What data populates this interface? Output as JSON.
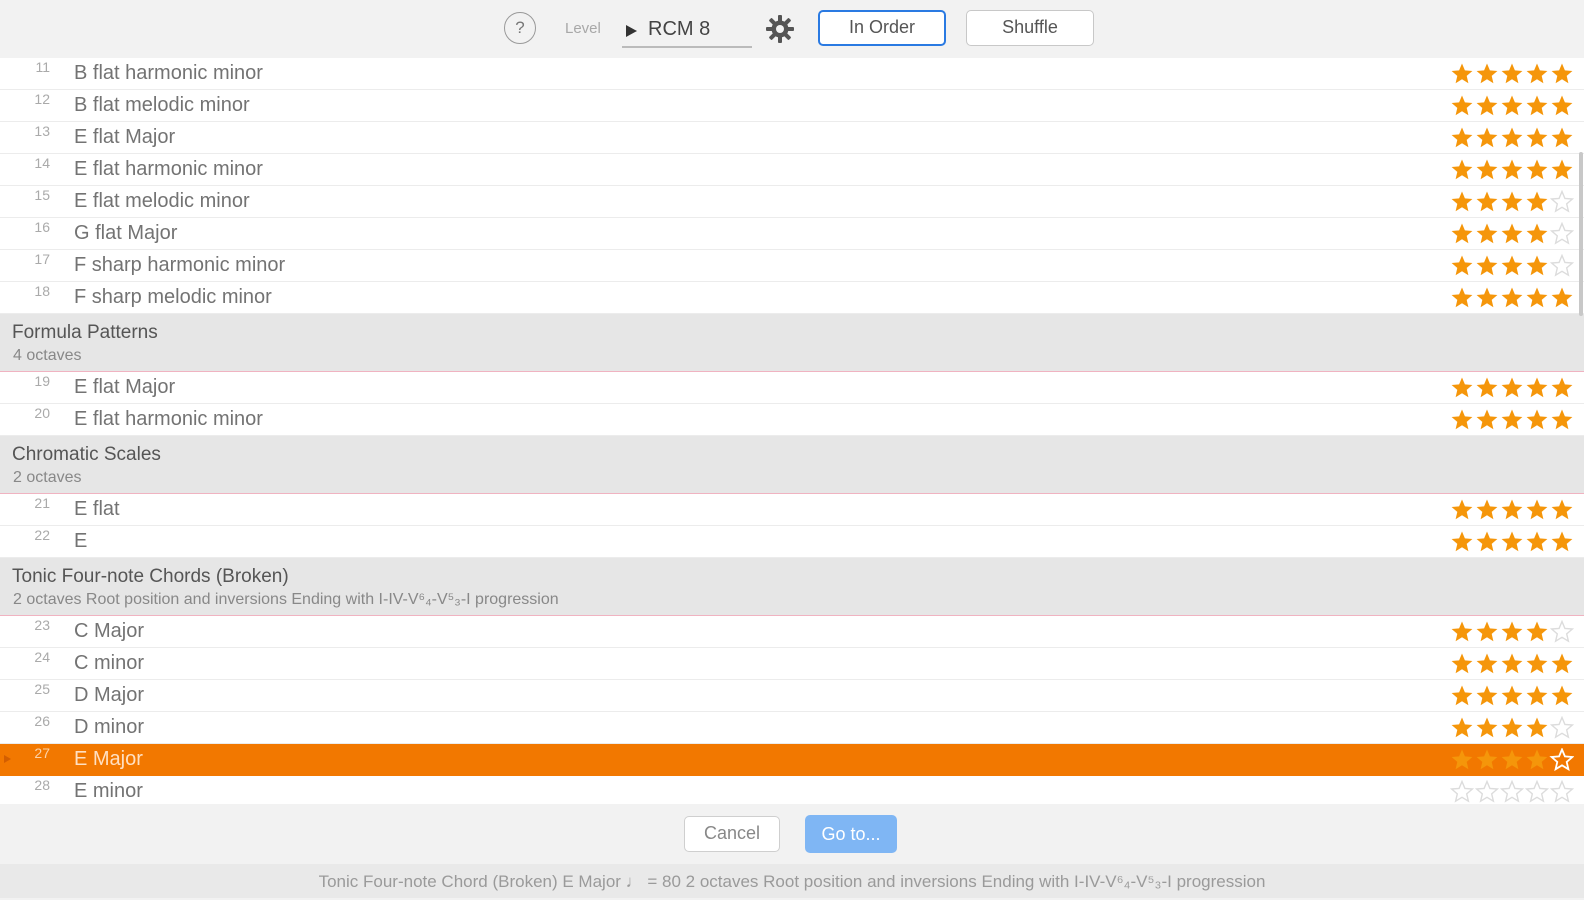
{
  "toolbar": {
    "help_label": "?",
    "level_label": "Level",
    "level_value": "RCM 8",
    "in_order_label": "In Order",
    "shuffle_label": "Shuffle"
  },
  "colors": {
    "accent": "#f27800",
    "star_filled": "#f5960a",
    "star_empty": "#dcdcdc",
    "selected_star_outline": "#ffffff",
    "primary_button": "#7fb6f4",
    "focus_border": "#2a7ae2"
  },
  "list": [
    {
      "kind": "row",
      "num": "11",
      "name": "B flat harmonic minor",
      "rating": 5
    },
    {
      "kind": "row",
      "num": "12",
      "name": "B flat melodic minor",
      "rating": 5
    },
    {
      "kind": "row",
      "num": "13",
      "name": "E flat Major",
      "rating": 5
    },
    {
      "kind": "row",
      "num": "14",
      "name": "E flat harmonic minor",
      "rating": 5
    },
    {
      "kind": "row",
      "num": "15",
      "name": "E flat melodic minor",
      "rating": 4
    },
    {
      "kind": "row",
      "num": "16",
      "name": "G flat Major",
      "rating": 4
    },
    {
      "kind": "row",
      "num": "17",
      "name": "F sharp harmonic minor",
      "rating": 4
    },
    {
      "kind": "row",
      "num": "18",
      "name": "F sharp melodic minor",
      "rating": 5
    },
    {
      "kind": "section",
      "title": "Formula Patterns",
      "sub": "4 octaves"
    },
    {
      "kind": "row",
      "num": "19",
      "name": "E flat Major",
      "rating": 5
    },
    {
      "kind": "row",
      "num": "20",
      "name": "E flat harmonic minor",
      "rating": 5
    },
    {
      "kind": "section",
      "title": "Chromatic Scales",
      "sub": "2 octaves"
    },
    {
      "kind": "row",
      "num": "21",
      "name": "E flat",
      "rating": 5
    },
    {
      "kind": "row",
      "num": "22",
      "name": "E",
      "rating": 5
    },
    {
      "kind": "section",
      "title": "Tonic Four-note Chords (Broken)",
      "sub": "2 octaves  Root position and inversions  Ending with I-IV-V⁶₄-V⁵₃-I progression"
    },
    {
      "kind": "row",
      "num": "23",
      "name": "C Major",
      "rating": 4
    },
    {
      "kind": "row",
      "num": "24",
      "name": "C minor",
      "rating": 5
    },
    {
      "kind": "row",
      "num": "25",
      "name": "D Major",
      "rating": 5
    },
    {
      "kind": "row",
      "num": "26",
      "name": "D minor",
      "rating": 4
    },
    {
      "kind": "row",
      "num": "27",
      "name": "E Major",
      "rating": 4,
      "selected": true
    },
    {
      "kind": "row",
      "num": "28",
      "name": "E minor",
      "rating": 0
    }
  ],
  "footer": {
    "cancel_label": "Cancel",
    "goto_label": "Go to...",
    "status_text": "Tonic Four-note Chord  (Broken)  E Major  ♩ = 80  2 octaves  Root position and inversions  Ending with I-IV-V⁶₄-V⁵₃-I progression"
  }
}
